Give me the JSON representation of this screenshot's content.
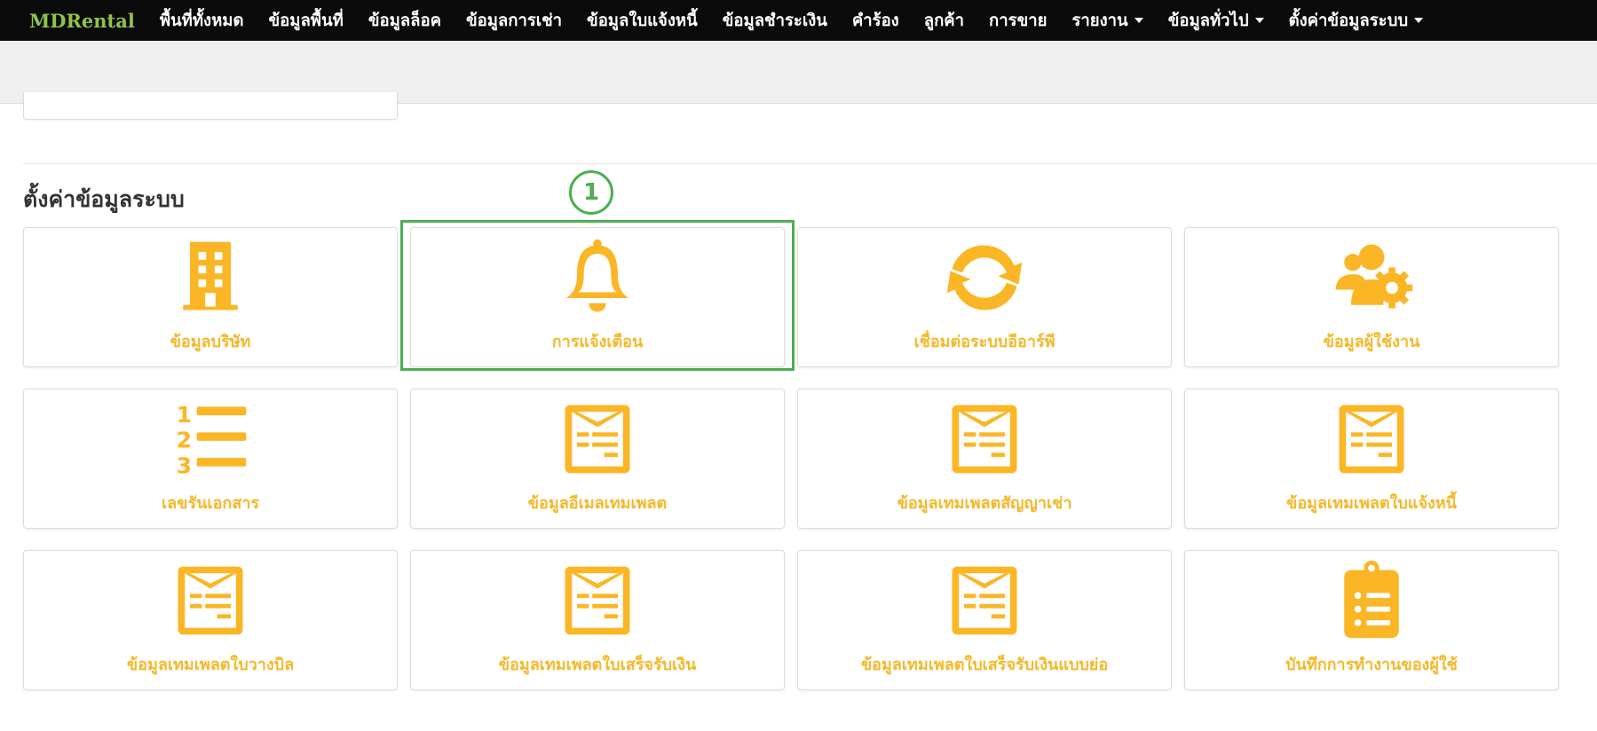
{
  "navbar": {
    "brand": "MDRental",
    "items": [
      {
        "label": "พื้นที่ทั้งหมด",
        "dropdown": false
      },
      {
        "label": "ข้อมูลพื้นที่",
        "dropdown": false
      },
      {
        "label": "ข้อมูลล็อค",
        "dropdown": false
      },
      {
        "label": "ข้อมูลการเช่า",
        "dropdown": false
      },
      {
        "label": "ข้อมูลใบแจ้งหนี้",
        "dropdown": false
      },
      {
        "label": "ข้อมูลชำระเงิน",
        "dropdown": false
      },
      {
        "label": "คำร้อง",
        "dropdown": false
      },
      {
        "label": "ลูกค้า",
        "dropdown": false
      },
      {
        "label": "การขาย",
        "dropdown": false
      },
      {
        "label": "รายงาน",
        "dropdown": true
      },
      {
        "label": "ข้อมูลทั่วไป",
        "dropdown": true
      },
      {
        "label": "ตั้งค่าข้อมูลระบบ",
        "dropdown": true
      }
    ]
  },
  "section": {
    "title": "ตั้งค่าข้อมูลระบบ"
  },
  "annotation": {
    "step_number": "1",
    "color": "#4caf50"
  },
  "theme": {
    "icon_color": "#fbb625",
    "label_color": "#f5b82a",
    "navbar_bg": "#0b0b0b",
    "brand_color": "#8fc44a"
  },
  "cards": [
    {
      "label": "ข้อมูลบริษัท",
      "icon": "building-icon"
    },
    {
      "label": "การแจ้งเตือน",
      "icon": "bell-icon"
    },
    {
      "label": "เชื่อมต่อระบบอีอาร์พี",
      "icon": "sync-icon"
    },
    {
      "label": "ข้อมูลผู้ใช้งาน",
      "icon": "users-gear-icon"
    },
    {
      "label": "เลขรันเอกสาร",
      "icon": "numbered-list-icon"
    },
    {
      "label": "ข้อมูลอีเมลเทมเพลต",
      "icon": "template-icon"
    },
    {
      "label": "ข้อมูลเทมเพลตสัญญาเช่า",
      "icon": "template-icon"
    },
    {
      "label": "ข้อมูลเทมเพลตใบแจ้งหนี้",
      "icon": "template-icon"
    },
    {
      "label": "ข้อมูลเทมเพลตใบวางบิล",
      "icon": "template-icon"
    },
    {
      "label": "ข้อมูลเทมเพลตใบเสร็จรับเงิน",
      "icon": "template-icon"
    },
    {
      "label": "ข้อมูลเทมเพลตใบเสร็จรับเงินแบบย่อ",
      "icon": "template-icon"
    },
    {
      "label": "บันทึกการทำงานของผู้ใช้",
      "icon": "clipboard-list-icon"
    }
  ]
}
